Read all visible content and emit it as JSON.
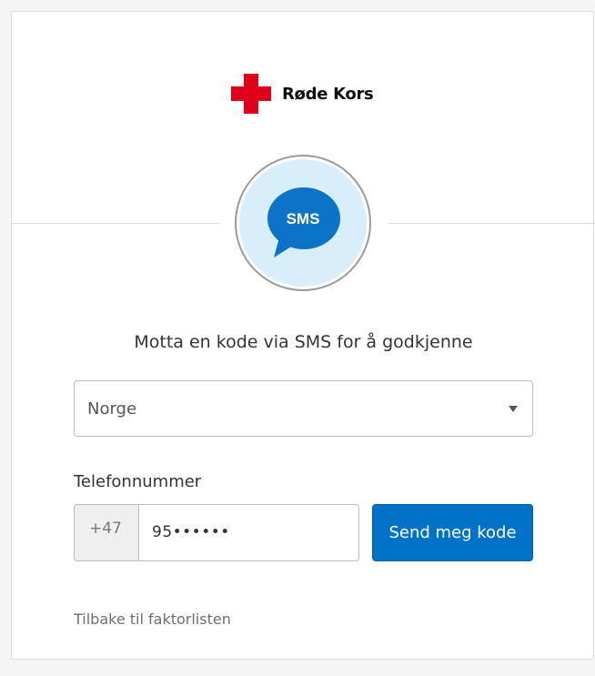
{
  "brand": {
    "name": "Røde Kors",
    "cross_color": "#e0001b"
  },
  "factor": {
    "icon": "sms-bubble-icon",
    "icon_text": "SMS",
    "bubble_color": "#0b73c8",
    "circle_fill": "#d9eefb"
  },
  "prompt": "Motta en kode via SMS for å godkjenne",
  "country": {
    "selected": "Norge"
  },
  "phone": {
    "label": "Telefonnummer",
    "prefix": "+47",
    "value": "95••••••"
  },
  "send_button": {
    "label": "Send meg kode",
    "color": "#0073c8"
  },
  "back_link": "Tilbake til faktorlisten"
}
